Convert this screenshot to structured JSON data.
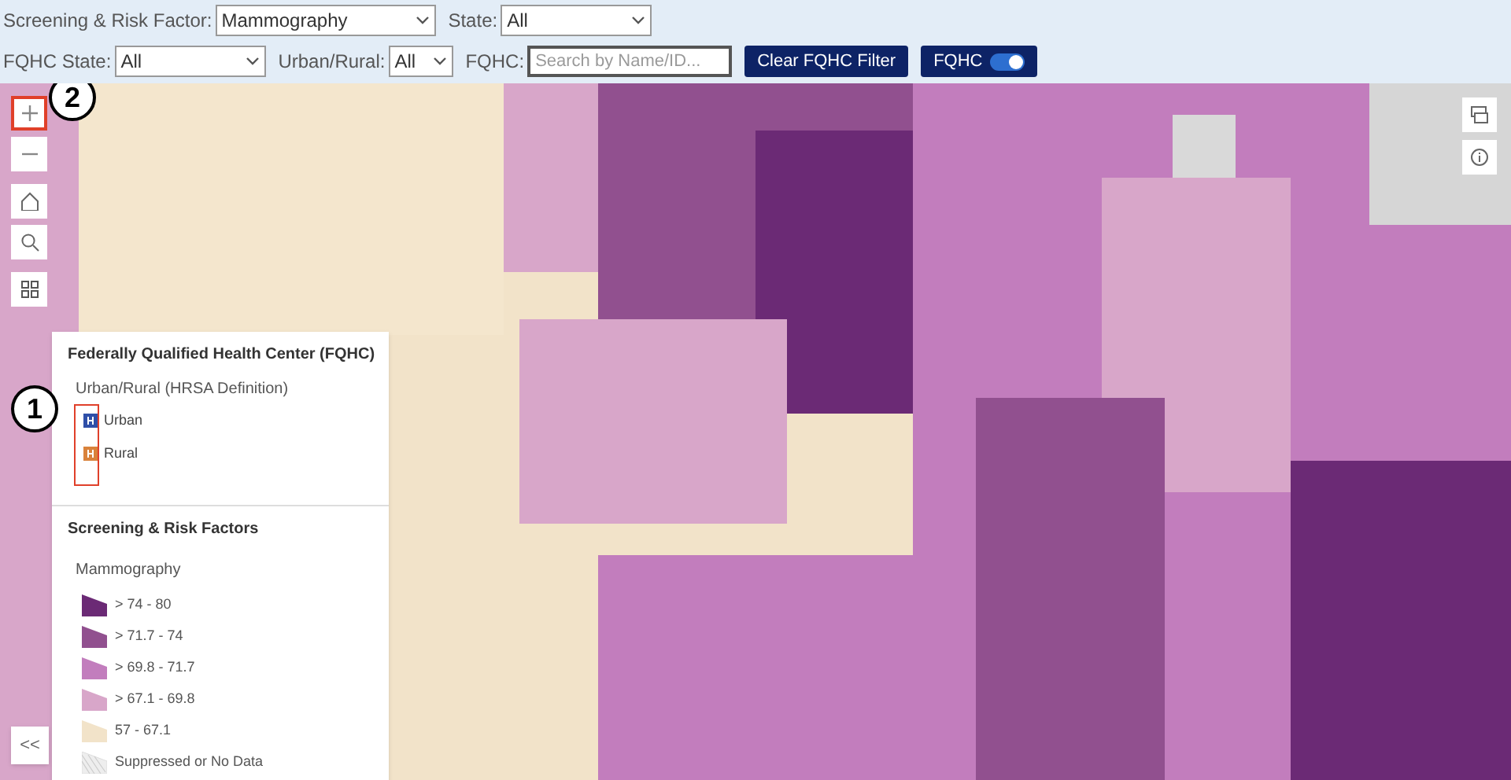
{
  "filters": [
    {
      "label": "Screening & Risk Factor:",
      "value": "Mammography",
      "kind": "select"
    },
    {
      "label": "State:",
      "value": "All",
      "kind": "select"
    }
  ],
  "filters_row2": [
    {
      "label": "FQHC State:",
      "value": "All",
      "kind": "select"
    },
    {
      "label": "Urban/Rural:",
      "value": "All",
      "kind": "select"
    },
    {
      "label": "FQHC:",
      "placeholder": "Search by Name/ID...",
      "kind": "search"
    }
  ],
  "clear_button": "Clear FQHC Filter",
  "fqhc_toggle": {
    "label": "FQHC",
    "on": true
  },
  "map": {
    "kind": "picture"
  },
  "map_controls": [
    {
      "kind": "zoom-in",
      "highlighted": true
    },
    {
      "kind": "zoom-out",
      "highlighted": false
    },
    {
      "kind": "home",
      "highlighted": false
    },
    {
      "kind": "search",
      "highlighted": false
    },
    {
      "kind": "basemap",
      "highlighted": false
    }
  ],
  "right_controls": [
    {
      "kind": "layers"
    },
    {
      "kind": "info"
    }
  ],
  "collapse_button": "<<",
  "callouts": [
    "2",
    "1"
  ],
  "legend": {
    "fqhc_title": "Federally Qualified Health Center (FQHC)",
    "fqhc_subtitle": "Urban/Rural (HRSA Definition)",
    "fqhc_items": [
      {
        "label": "Urban",
        "color": "#2f4fa8"
      },
      {
        "label": "Rural",
        "color": "#d9823b"
      }
    ],
    "screening_title": "Screening & Risk Factors",
    "measure": "Mammography",
    "classes": [
      {
        "label": "> 74 - 80",
        "color": "#6b2a75",
        "kind": "fill"
      },
      {
        "label": "> 71.7 - 74",
        "color": "#91508f",
        "kind": "fill"
      },
      {
        "label": "> 69.8 - 71.7",
        "color": "#c27dbd",
        "kind": "fill"
      },
      {
        "label": "> 67.1 - 69.8",
        "color": "#d8a6c9",
        "kind": "fill"
      },
      {
        "label": "57 - 67.1",
        "color": "#f2e3c9",
        "kind": "fill"
      },
      {
        "label": "Suppressed or No Data",
        "color": "#eeeeee",
        "kind": "hatch"
      }
    ]
  }
}
